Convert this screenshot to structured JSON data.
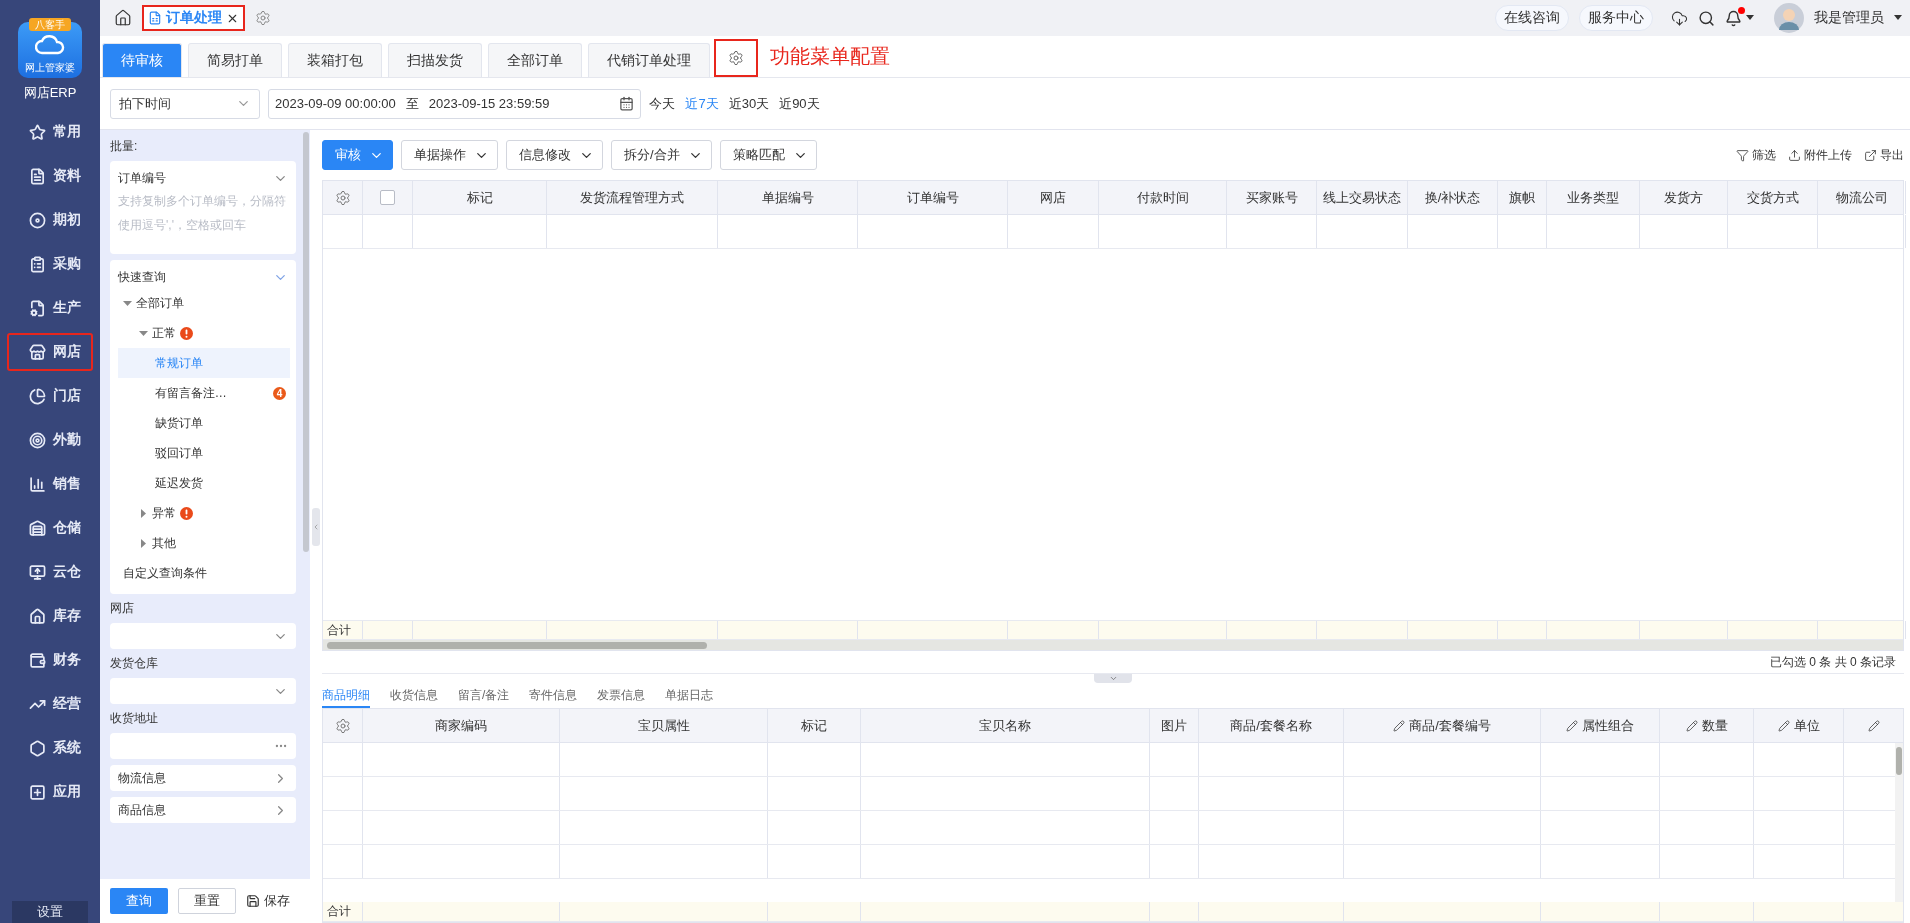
{
  "sidebar": {
    "logo": {
      "badge": "八客手",
      "caption": "网上管家婆"
    },
    "app_name": "网店ERP",
    "items": [
      {
        "label": "常用",
        "selected": false,
        "annotated": false
      },
      {
        "label": "资料",
        "selected": false,
        "annotated": false
      },
      {
        "label": "期初",
        "selected": false,
        "annotated": false
      },
      {
        "label": "采购",
        "selected": false,
        "annotated": false
      },
      {
        "label": "生产",
        "selected": false,
        "annotated": false
      },
      {
        "label": "网店",
        "selected": false,
        "annotated": true
      },
      {
        "label": "门店",
        "selected": false,
        "annotated": false
      },
      {
        "label": "外勤",
        "selected": false,
        "annotated": false
      },
      {
        "label": "销售",
        "selected": false,
        "annotated": false
      },
      {
        "label": "仓储",
        "selected": false,
        "annotated": false
      },
      {
        "label": "云仓",
        "selected": false,
        "annotated": false
      },
      {
        "label": "库存",
        "selected": false,
        "annotated": false
      },
      {
        "label": "财务",
        "selected": false,
        "annotated": false
      },
      {
        "label": "经营",
        "selected": false,
        "annotated": false
      },
      {
        "label": "系统",
        "selected": false,
        "annotated": false
      },
      {
        "label": "应用",
        "selected": false,
        "annotated": false
      }
    ],
    "footer": "设置"
  },
  "top_bar": {
    "page_tabs": [
      {
        "label": "订单处理",
        "selected": true,
        "annotated": true
      }
    ],
    "buttons": [
      "在线咨询",
      "服务中心"
    ],
    "has_notification": true,
    "user": "我是管理员"
  },
  "function_tabs": [
    {
      "label": "待审核",
      "selected": true
    },
    {
      "label": "简易打单",
      "selected": false
    },
    {
      "label": "装箱打包",
      "selected": false
    },
    {
      "label": "扫描发货",
      "selected": false
    },
    {
      "label": "全部订单",
      "selected": false
    },
    {
      "label": "代销订单处理",
      "selected": false
    }
  ],
  "menu_config": {
    "annotated": true,
    "note": "功能菜单配置"
  },
  "filters": {
    "time_field": "拍下时间",
    "start": "2023-09-09 00:00:00",
    "separator": "至",
    "end": "2023-09-15 23:59:59",
    "quick_ranges": [
      {
        "label": "今天",
        "selected": false
      },
      {
        "label": "近7天",
        "selected": true
      },
      {
        "label": "近30天",
        "selected": false
      },
      {
        "label": "近90天",
        "selected": false
      }
    ]
  },
  "query_panel": {
    "batch_label": "批量:",
    "batch_type": "订单编号",
    "batch_placeholder": "支持复制多个订单编号，分隔符使用逗号','，空格或回车",
    "quick_query_title": "快速查询",
    "tree": [
      {
        "label": "全部订单",
        "expanded": true,
        "selected": false,
        "alert": false,
        "children": [
          {
            "label": "正常",
            "expanded": true,
            "selected": false,
            "alert": true,
            "children": [
              {
                "label": "常规订单",
                "selected": true,
                "alert": false
              },
              {
                "label": "有留言备注…",
                "selected": false,
                "alert": false,
                "badge": "4"
              },
              {
                "label": "缺货订单",
                "selected": false,
                "alert": false
              },
              {
                "label": "驳回订单",
                "selected": false,
                "alert": false
              },
              {
                "label": "延迟发货",
                "selected": false,
                "alert": false
              }
            ]
          },
          {
            "label": "异常",
            "expanded": false,
            "selected": false,
            "alert": true
          },
          {
            "label": "其他",
            "expanded": false,
            "selected": false,
            "alert": false
          }
        ]
      },
      {
        "label": "自定义查询条件",
        "selected": false,
        "alert": false
      }
    ],
    "fields": [
      {
        "kind": "select",
        "label": "网店"
      },
      {
        "kind": "select",
        "label": "发货仓库"
      },
      {
        "kind": "more",
        "label": "收货地址"
      },
      {
        "kind": "link",
        "label": "物流信息"
      },
      {
        "kind": "link",
        "label": "商品信息"
      }
    ],
    "buttons": [
      {
        "kind": "primary",
        "label": "查询"
      },
      {
        "kind": "plain",
        "label": "重置"
      },
      {
        "kind": "save",
        "label": "保存"
      }
    ]
  },
  "toolbar": {
    "buttons": [
      {
        "label": "审核",
        "primary": true
      },
      {
        "label": "单据操作",
        "primary": false
      },
      {
        "label": "信息修改",
        "primary": false
      },
      {
        "label": "拆分/合并",
        "primary": false
      },
      {
        "label": "策略匹配",
        "primary": false
      }
    ],
    "actions": [
      {
        "kind": "filter",
        "label": "筛选"
      },
      {
        "kind": "upload",
        "label": "附件上传"
      },
      {
        "kind": "export",
        "label": "导出"
      }
    ]
  },
  "orders_table": {
    "select_all": {
      "checked": false
    },
    "columns": [
      "标记",
      "发货流程管理方式",
      "单据编号",
      "订单编号",
      "网店",
      "付款时间",
      "买家账号",
      "线上交易状态",
      "换/补状态",
      "旗帜",
      "业务类型",
      "发货方",
      "交货方式",
      "物流公司"
    ],
    "total_label": "合计",
    "status": "已勾选 0 条 共 0 条记录"
  },
  "detail_tabs": [
    {
      "label": "商品明细",
      "selected": true
    },
    {
      "label": "收货信息",
      "selected": false
    },
    {
      "label": "留言/备注",
      "selected": false
    },
    {
      "label": "寄件信息",
      "selected": false
    },
    {
      "label": "发票信息",
      "selected": false
    },
    {
      "label": "单据日志",
      "selected": false
    }
  ],
  "detail_table": {
    "columns": [
      {
        "label": "商家编码",
        "editable": false
      },
      {
        "label": "宝贝属性",
        "editable": false
      },
      {
        "label": "标记",
        "editable": false
      },
      {
        "label": "宝贝名称",
        "editable": false
      },
      {
        "label": "图片",
        "editable": false
      },
      {
        "label": "商品/套餐名称",
        "editable": false
      },
      {
        "label": "商品/套餐编号",
        "editable": true
      },
      {
        "label": "属性组合",
        "editable": true
      },
      {
        "label": "数量",
        "editable": true
      },
      {
        "label": "单位",
        "editable": true
      },
      {
        "editable": true
      }
    ],
    "total_label": "合计"
  }
}
